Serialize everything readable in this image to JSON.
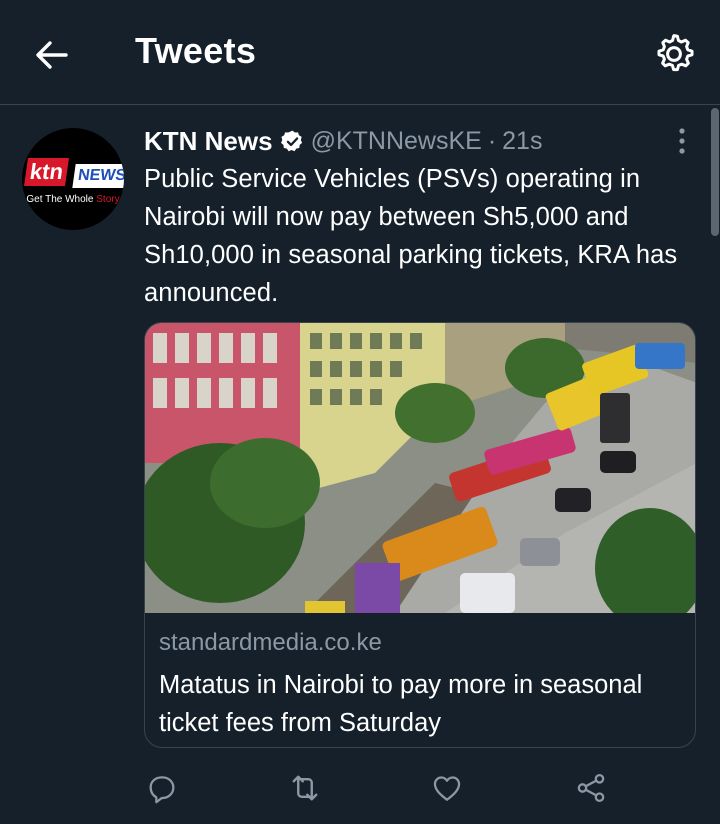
{
  "header": {
    "title": "Tweets",
    "back_icon": "arrow-left-icon",
    "settings_icon": "gear-icon"
  },
  "tweet": {
    "author": "KTN News",
    "verified": true,
    "handle": "@KTNNewsKE",
    "separator": "·",
    "time": "21s",
    "text": "Public Service Vehicles (PSVs) operating in Nairobi will now pay between Sh5,000 and Sh10,000 in seasonal parking tickets, KRA has announced.",
    "avatar": {
      "word": "ktn",
      "badge": "NEWS",
      "tagline_a": "Get The Whole ",
      "tagline_b": "Story"
    },
    "card": {
      "domain": "standardmedia.co.ke",
      "title": "Matatus in Nairobi to pay more in seasonal ticket fees from Saturday"
    },
    "actions": [
      "reply-icon",
      "retweet-icon",
      "like-icon",
      "share-icon"
    ]
  },
  "colors": {
    "background": "#15202b",
    "border": "#38444d",
    "muted": "#8b98a5",
    "brand_red": "#d7182a"
  }
}
